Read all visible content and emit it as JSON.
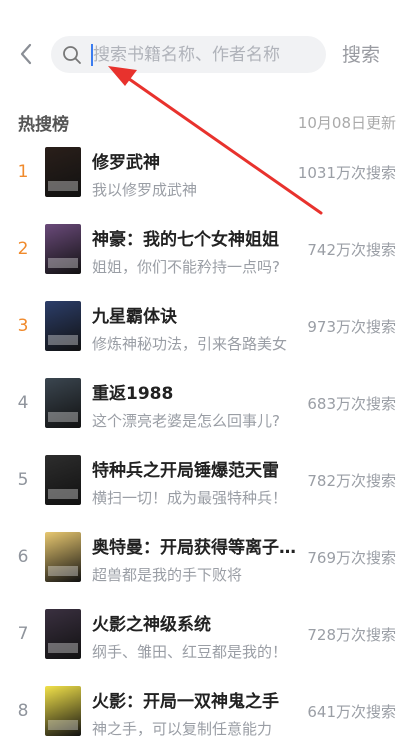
{
  "search": {
    "placeholder": "搜索书籍名称、作者名称",
    "button_label": "搜索"
  },
  "hot": {
    "title": "热搜榜",
    "updated": "10月08日更新"
  },
  "items": [
    {
      "rank": "1",
      "title": "修罗武神",
      "desc": "我以修罗成武神",
      "count": "1031万次搜索",
      "cover": "#2a1f1a"
    },
    {
      "rank": "2",
      "title": "神豪：我的七个女神姐姐",
      "desc": "姐姐，你们不能矜持一点吗?",
      "count": "742万次搜索",
      "cover": "#6a4a7a"
    },
    {
      "rank": "3",
      "title": "九星霸体诀",
      "desc": "修炼神秘功法，引来各路美女",
      "count": "973万次搜索",
      "cover": "#2c3e6a"
    },
    {
      "rank": "4",
      "title": "重返1988",
      "desc": "这个漂亮老婆是怎么回事儿?",
      "count": "683万次搜索",
      "cover": "#3b4650"
    },
    {
      "rank": "5",
      "title": "特种兵之开局锤爆范天雷",
      "desc": "横扫一切！成为最强特种兵！",
      "count": "782万次搜索",
      "cover": "#2d2d2d"
    },
    {
      "rank": "6",
      "title": "奥特曼：开局获得等离子火花塔",
      "desc": "超兽都是我的手下败将",
      "count": "769万次搜索",
      "cover": "#e8c870"
    },
    {
      "rank": "7",
      "title": "火影之神级系统",
      "desc": "纲手、雏田、红豆都是我的！",
      "count": "728万次搜索",
      "cover": "#3a3040"
    },
    {
      "rank": "8",
      "title": "火影：开局一双神鬼之手",
      "desc": "神之手，可以复制任意能力",
      "count": "641万次搜索",
      "cover": "#f2e24a"
    }
  ],
  "colors": {
    "hot_rank": "#f08a2c",
    "rank": "#8f949c",
    "arrow": "#e8322d"
  }
}
